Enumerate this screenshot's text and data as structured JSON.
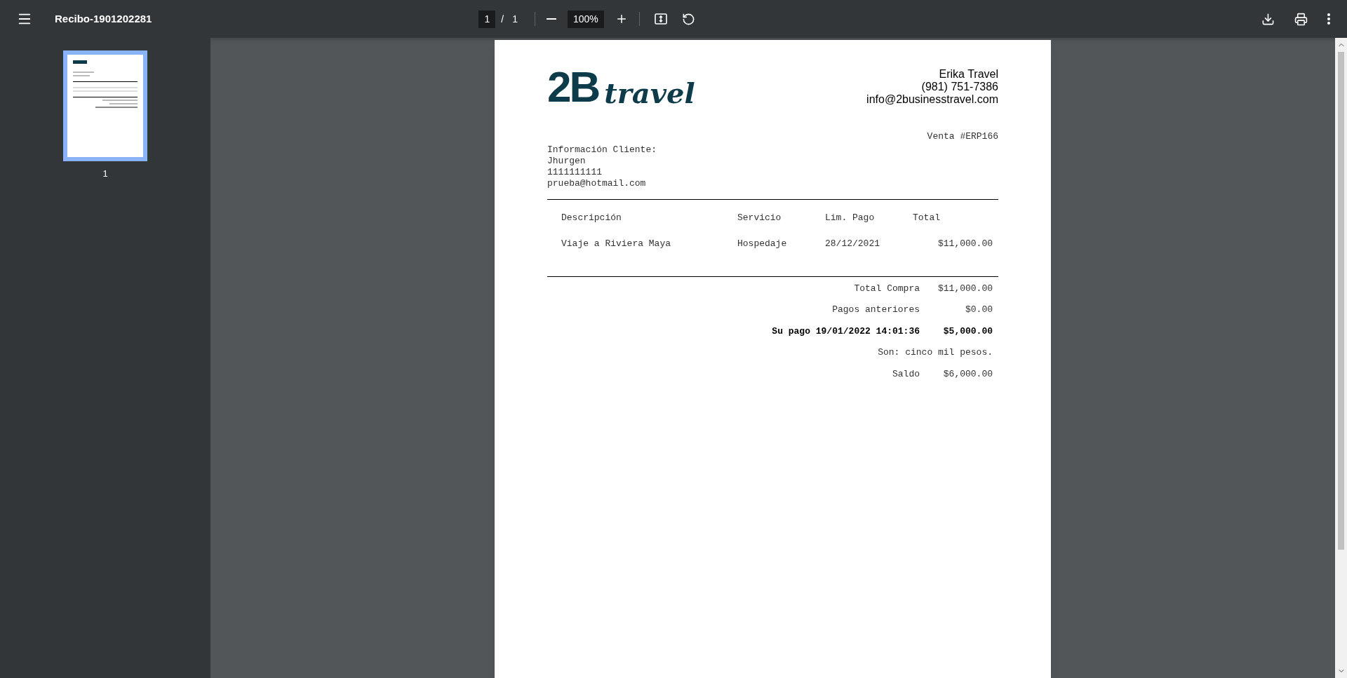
{
  "toolbar": {
    "title": "Recibo-1901202281",
    "page_current": "1",
    "page_separator": "/",
    "page_total": "1",
    "zoom": "100%"
  },
  "sidebar": {
    "thumbnails": [
      {
        "label": "1",
        "selected": true
      }
    ]
  },
  "document": {
    "logo": {
      "mark": "2B",
      "script": "travel"
    },
    "company": [
      "Erika Travel",
      "(981) 751-7386",
      "info@2businesstravel.com"
    ],
    "sale": "Venta #ERP166",
    "client": [
      "Información Cliente:",
      "Jhurgen",
      "1111111111",
      "prueba@hotmail.com"
    ],
    "table": {
      "columns": [
        "Descripción",
        "Servicio",
        "Lim. Pago",
        "Total"
      ],
      "rows": [
        [
          "Viaje a Riviera Maya",
          "Hospedaje",
          "28/12/2021",
          "$11,000.00"
        ]
      ]
    },
    "totals": [
      {
        "label": "Total Compra",
        "value": "$11,000.00",
        "bold": false
      },
      {
        "label": "Pagos anteriores",
        "value": "$0.00",
        "bold": false
      },
      {
        "label": "Su pago 19/01/2022 14:01:36",
        "value": "$5,000.00",
        "bold": true
      }
    ],
    "amount_words": "Son: cinco mil pesos.",
    "balance": {
      "label": "Saldo",
      "value": "$6,000.00"
    }
  }
}
